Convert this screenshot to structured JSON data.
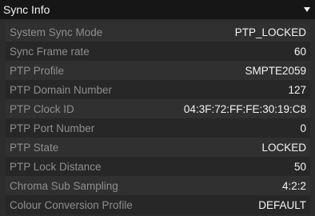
{
  "panel": {
    "title": "Sync Info",
    "caret_icon": "triangle-down-icon"
  },
  "rows": [
    {
      "label": "System Sync Mode",
      "value": "PTP_LOCKED"
    },
    {
      "label": "Sync Frame rate",
      "value": "60"
    },
    {
      "label": "PTP Profile",
      "value": "SMPTE2059"
    },
    {
      "label": "PTP Domain Number",
      "value": "127"
    },
    {
      "label": "PTP Clock ID",
      "value": "04:3F:72:FF:FE:30:19:C8"
    },
    {
      "label": "PTP Port Number",
      "value": "0"
    },
    {
      "label": "PTP State",
      "value": "LOCKED"
    },
    {
      "label": "PTP Lock Distance",
      "value": "50"
    },
    {
      "label": "Chroma Sub Sampling",
      "value": "4:2:2"
    },
    {
      "label": "Colour Conversion Profile",
      "value": "DEFAULT"
    }
  ],
  "colors": {
    "header_bg": "#161616",
    "panel_bg": "#2c2c2c",
    "label_text": "#8e8e8e",
    "value_text": "#f3f3f3"
  }
}
